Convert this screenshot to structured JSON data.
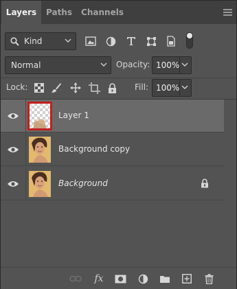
{
  "tabs": [
    {
      "label": "Layers",
      "active": true
    },
    {
      "label": "Paths",
      "active": false
    },
    {
      "label": "Channels",
      "active": false
    }
  ],
  "filter": {
    "kind_label": "Kind",
    "icons": [
      "pixel-filter-icon",
      "adjustment-filter-icon",
      "type-filter-icon",
      "shape-filter-icon",
      "smart-object-filter-icon",
      "filter-toggle"
    ]
  },
  "blend": {
    "mode": "Normal",
    "opacity_label": "Opacity:",
    "opacity_value": "100%"
  },
  "lock": {
    "label": "Lock:",
    "fill_label": "Fill:",
    "fill_value": "100%",
    "icons": [
      "lock-transparent-pixels-icon",
      "lock-image-pixels-icon",
      "lock-position-icon",
      "lock-artboard-icon",
      "lock-all-icon"
    ]
  },
  "layers": [
    {
      "name": "Layer 1",
      "selected": true,
      "italic": false,
      "locked": false,
      "thumb": "transparent-with-image"
    },
    {
      "name": "Background copy",
      "selected": false,
      "italic": false,
      "locked": false,
      "thumb": "portrait"
    },
    {
      "name": "Background",
      "selected": false,
      "italic": true,
      "locked": true,
      "thumb": "portrait"
    }
  ],
  "footer_icons": [
    "link-icon",
    "fx-icon",
    "add-mask-icon",
    "adjustment-layer-icon",
    "new-group-icon",
    "new-layer-icon",
    "delete-icon"
  ],
  "colors": {
    "panel_bg": "#535353",
    "tab_bar_bg": "#3f3f3f",
    "selected_row": "#6a6a6a",
    "selection_outline": "#c21f1f"
  }
}
